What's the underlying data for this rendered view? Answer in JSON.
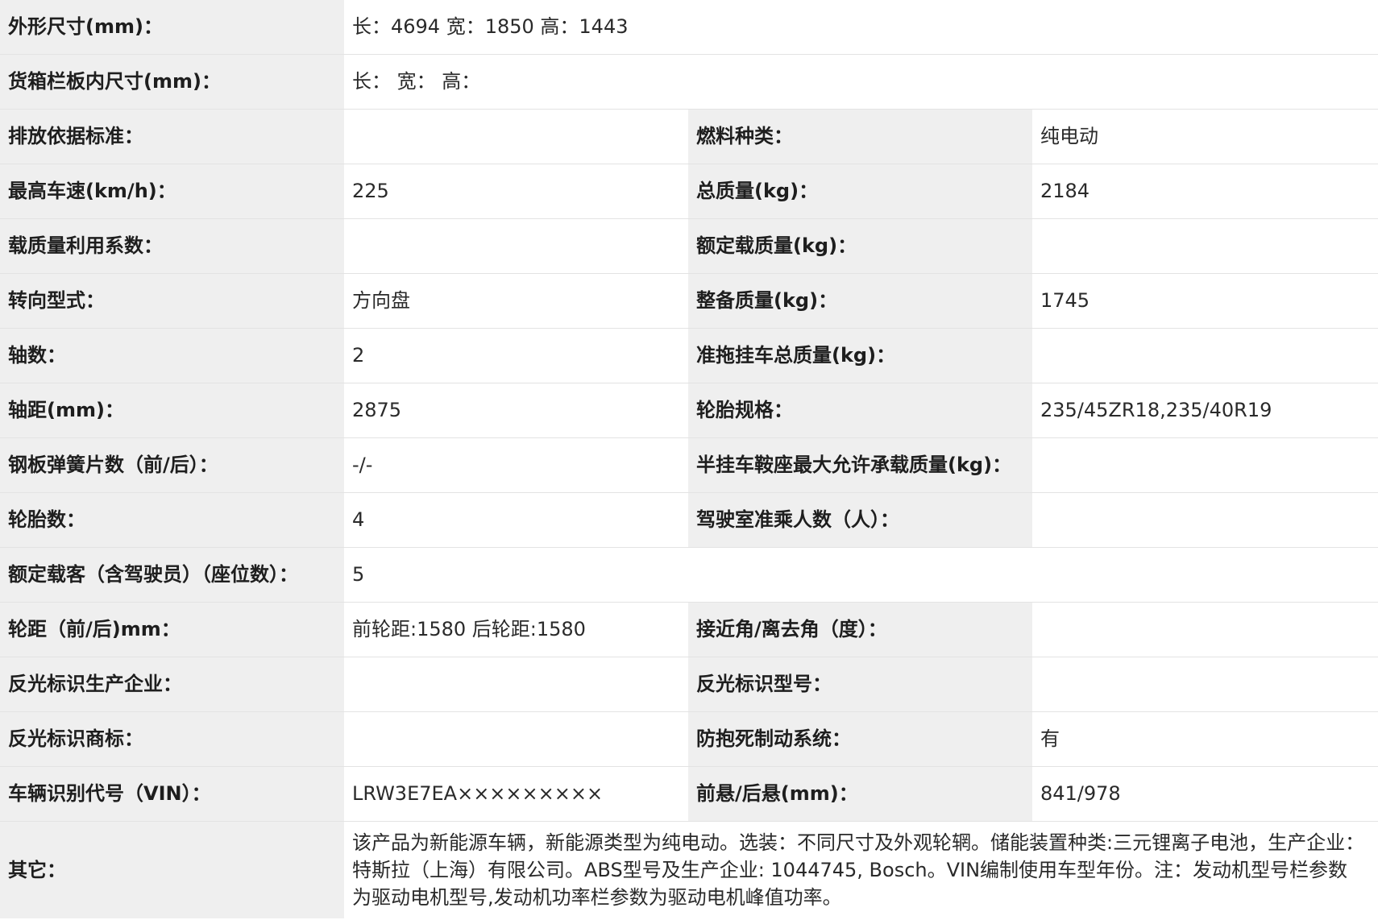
{
  "rows": [
    {
      "l1": "外形尺寸(mm)：",
      "v1": "长：4694 宽：1850 高：1443"
    },
    {
      "l1": "货箱栏板内尺寸(mm)：",
      "v1": "长： 宽： 高："
    },
    {
      "l1": "排放依据标准：",
      "v1": "",
      "l2": "燃料种类：",
      "v2": "纯电动"
    },
    {
      "l1": "最高车速(km/h)：",
      "v1": "225",
      "l2": "总质量(kg)：",
      "v2": "2184"
    },
    {
      "l1": "载质量利用系数：",
      "v1": "",
      "l2": "额定载质量(kg)：",
      "v2": ""
    },
    {
      "l1": "转向型式：",
      "v1": "方向盘",
      "l2": "整备质量(kg)：",
      "v2": "1745"
    },
    {
      "l1": "轴数：",
      "v1": "2",
      "l2": "准拖挂车总质量(kg)：",
      "v2": ""
    },
    {
      "l1": "轴距(mm)：",
      "v1": "2875",
      "l2": "轮胎规格：",
      "v2": "235/45ZR18,235/40R19"
    },
    {
      "l1": "钢板弹簧片数（前/后）：",
      "v1": "-/-",
      "l2": "半挂车鞍座最大允许承载质量(kg)：",
      "v2": ""
    },
    {
      "l1": "轮胎数：",
      "v1": "4",
      "l2": "驾驶室准乘人数（人）：",
      "v2": ""
    },
    {
      "l1": "额定载客（含驾驶员）（座位数）：",
      "v1": "5"
    },
    {
      "l1": "轮距（前/后)mm：",
      "v1": "前轮距:1580 后轮距:1580",
      "l2": "接近角/离去角（度）：",
      "v2": ""
    },
    {
      "l1": "反光标识生产企业：",
      "v1": "",
      "l2": "反光标识型号：",
      "v2": ""
    },
    {
      "l1": "反光标识商标：",
      "v1": "",
      "l2": "防抱死制动系统：",
      "v2": "有"
    },
    {
      "l1": "车辆识别代号（VIN）：",
      "v1": "LRW3E7EA×××××××××",
      "l2": "前悬/后悬(mm)：",
      "v2": "841/978"
    },
    {
      "l1": "其它：",
      "v1": "该产品为新能源车辆，新能源类型为纯电动。选装：不同尺寸及外观轮辋。储能装置种类:三元锂离子电池，生产企业：特斯拉（上海）有限公司。ABS型号及生产企业: 1044745, Bosch。VIN编制使用车型年份。注：发动机型号栏参数为驱动电机型号,发动机功率栏参数为驱动电机峰值功率。"
    }
  ]
}
